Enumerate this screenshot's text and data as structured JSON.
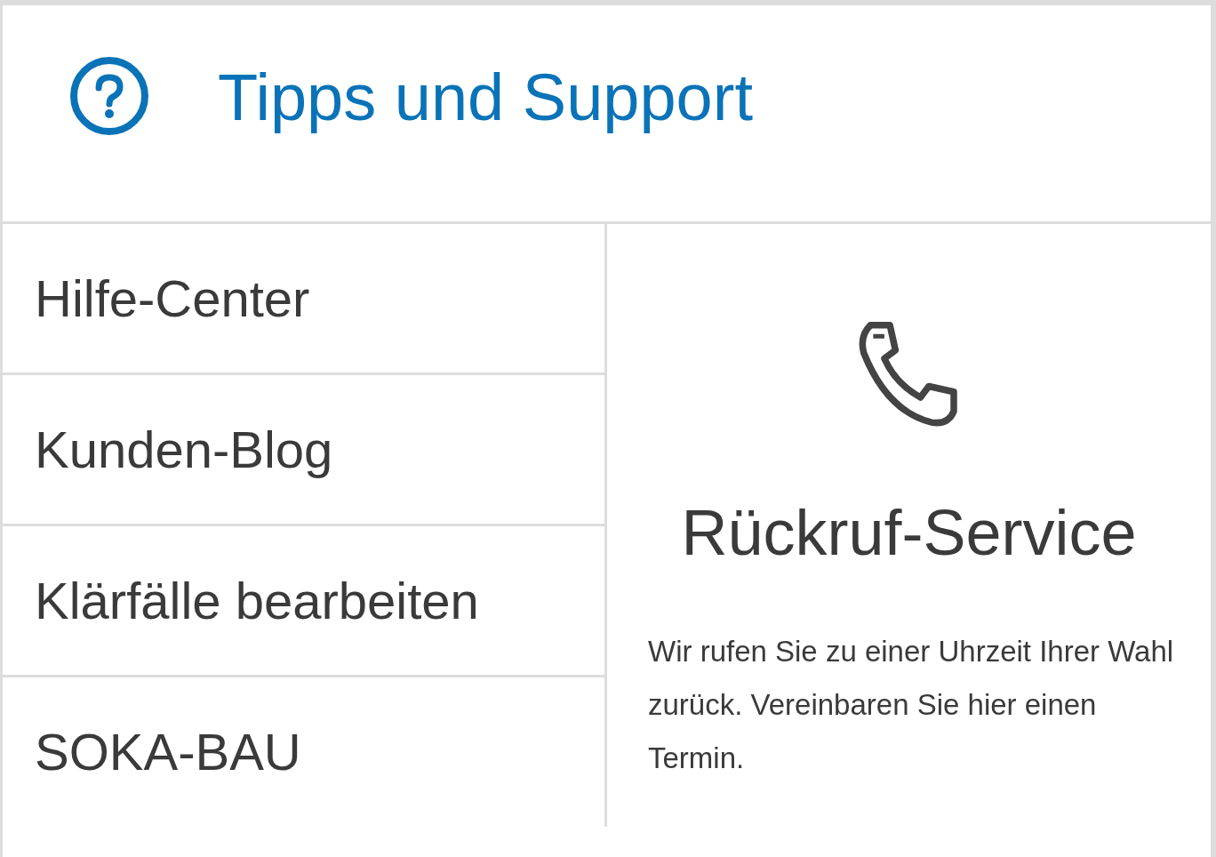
{
  "header": {
    "title": "Tipps und Support"
  },
  "links": [
    {
      "label": "Hilfe-Center"
    },
    {
      "label": "Kunden-Blog"
    },
    {
      "label": "Klärfälle bearbeiten"
    },
    {
      "label": "SOKA-BAU"
    }
  ],
  "callback": {
    "title": "Rückruf-Service",
    "text": "Wir rufen Sie zu einer Uhrzeit Ihrer Wahl zurück. Vereinbaren Sie hier einen Termin."
  }
}
